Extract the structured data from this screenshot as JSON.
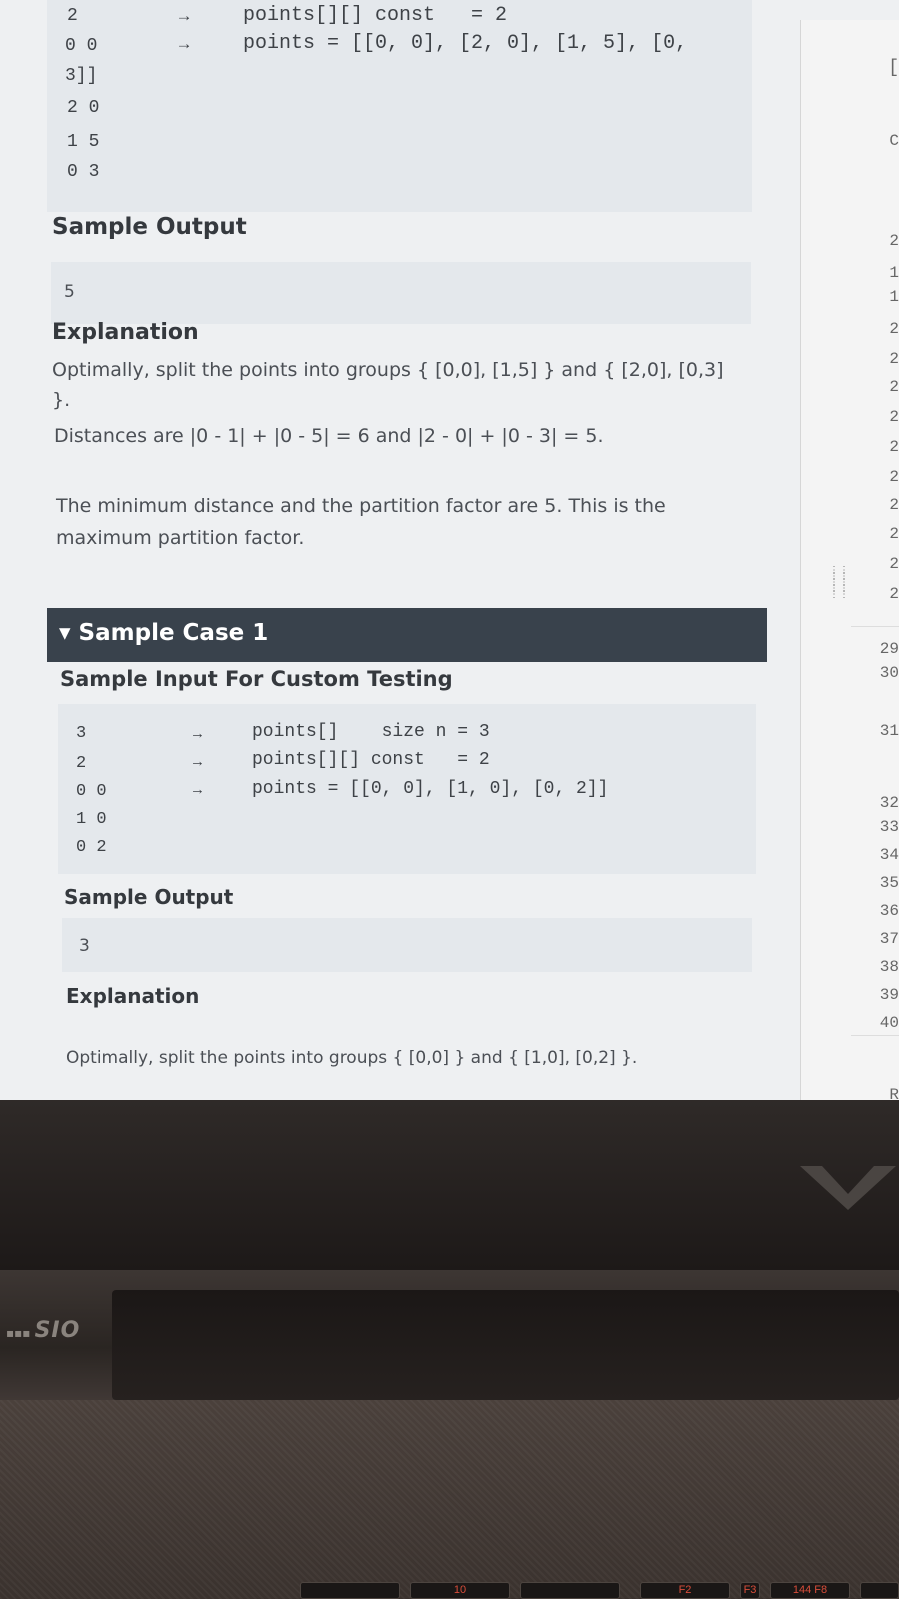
{
  "case0": {
    "input_lines": [
      "2",
      "0 0",
      "3]]",
      "2 0",
      "1 5",
      "0 3"
    ],
    "arrows": [
      "→",
      "→"
    ],
    "annotations": [
      "points[][] const   = 2",
      "points = [[0, 0], [2, 0], [1, 5], [0,"
    ],
    "output_heading": "Sample Output",
    "output_value": "5",
    "explanation_heading": "Explanation",
    "explanation_lines": [
      "Optimally, split the points into groups { [0,0], [1,5] } and { [2,0], [0,3]",
      "}.",
      "Distances are |0 - 1| + |0 - 5| = 6 and |2 - 0| + |0 - 3| = 5."
    ],
    "conclusion_lines": [
      "The minimum distance and the partition factor are 5. This is the",
      "maximum partition factor."
    ]
  },
  "case1": {
    "toggle_label": "▾ Sample Case 1",
    "input_heading": "Sample Input For Custom Testing",
    "input_lines": [
      "3",
      "2",
      "0 0",
      "1 0",
      "0 2"
    ],
    "arrows": [
      "→",
      "→",
      "→"
    ],
    "annotations": [
      "points[]    size n = 3",
      "points[][] const   = 2",
      "points = [[0, 0], [1, 0], [0, 2]]"
    ],
    "output_heading": "Sample Output",
    "output_value": "3",
    "explanation_heading": "Explanation",
    "explanation_line": "Optimally, split the points into groups { [0,0] } and { [1,0], [0,2] }."
  },
  "editor": {
    "line_numbers_partial": [
      "[",
      "C",
      "2",
      "1",
      "1",
      "2",
      "2",
      "2",
      "2",
      "2",
      "2",
      "2",
      "2",
      "2",
      "2"
    ],
    "line_numbers": [
      "29",
      "30",
      "31",
      "32",
      "33",
      "34",
      "35",
      "36",
      "37",
      "38",
      "39",
      "40"
    ],
    "last_partial": "R"
  },
  "laptop": {
    "brand": "SIO",
    "keys": [
      "",
      "10",
      "",
      "F2",
      "F3",
      "144 F8",
      ""
    ]
  },
  "colors": {
    "case_bar": "#39424c",
    "screen_bg": "#eef0f2",
    "code_bg": "#e4e8ec",
    "key_legend": "#d84d3a"
  }
}
